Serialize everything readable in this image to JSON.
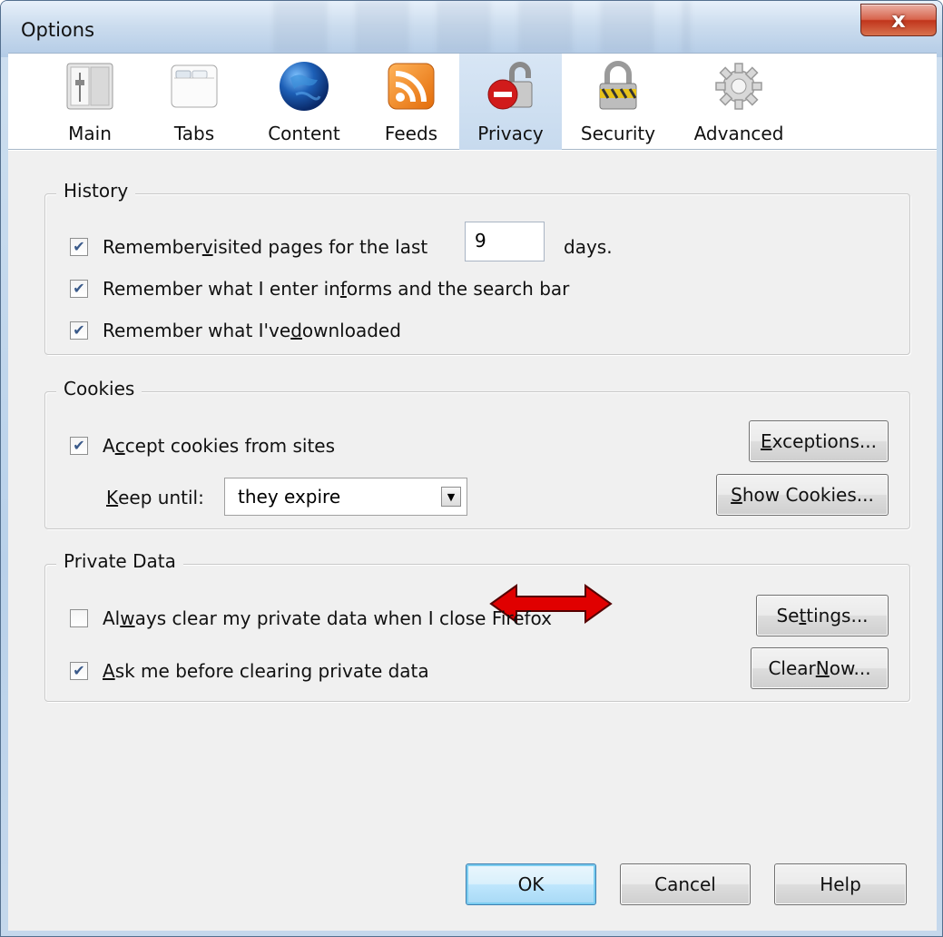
{
  "window": {
    "title": "Options",
    "close_glyph": "x"
  },
  "toolbar": {
    "items": [
      {
        "label": "Main",
        "icon": "main-switch-icon"
      },
      {
        "label": "Tabs",
        "icon": "tabs-icon"
      },
      {
        "label": "Content",
        "icon": "globe-icon"
      },
      {
        "label": "Feeds",
        "icon": "rss-feed-icon"
      },
      {
        "label": "Privacy",
        "icon": "privacy-lock-icon",
        "active": true
      },
      {
        "label": "Security",
        "icon": "padlock-icon"
      },
      {
        "label": "Advanced",
        "icon": "gear-icon"
      }
    ]
  },
  "history": {
    "legend": "History",
    "remember_pages_pre": "Remember ",
    "remember_pages_u": "v",
    "remember_pages_post": "isited pages for the last",
    "days_value": "9",
    "days_suffix": "days.",
    "remember_forms_pre": "Remember what I enter in ",
    "remember_forms_u": "f",
    "remember_forms_post": "orms and the search bar",
    "remember_downloads_pre": "Remember what I've ",
    "remember_downloads_u": "d",
    "remember_downloads_post": "ownloaded",
    "checked": [
      true,
      true,
      true
    ]
  },
  "cookies": {
    "legend": "Cookies",
    "accept_pre": "A",
    "accept_u": "c",
    "accept_post": "cept cookies from sites",
    "accept_checked": true,
    "keep_until_u": "K",
    "keep_until_post": "eep until:",
    "keep_until_value": "they expire",
    "exceptions_u": "E",
    "exceptions_post": "xceptions...",
    "show_u": "S",
    "show_post": "how Cookies..."
  },
  "private_data": {
    "legend": "Private Data",
    "always_pre": "Al",
    "always_u": "w",
    "always_post": "ays clear my private data when I close Firefox",
    "always_checked": false,
    "ask_u": "A",
    "ask_post": "sk me before clearing private data",
    "ask_checked": true,
    "settings_pre": "Se",
    "settings_u": "t",
    "settings_post": "tings...",
    "clear_pre": "Clear ",
    "clear_u": "N",
    "clear_post": "ow..."
  },
  "footer": {
    "ok": "OK",
    "cancel": "Cancel",
    "help": "Help"
  },
  "colors": {
    "annotation_arrow": "#e00000",
    "active_tab": "#c7daee"
  }
}
